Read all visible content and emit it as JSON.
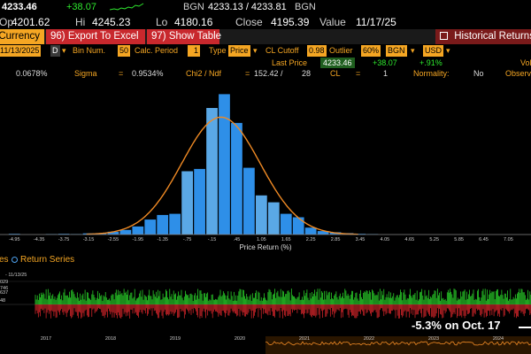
{
  "header": {
    "last": "4233.46",
    "change": "+38.07",
    "bgn_label": "BGN",
    "bid_ask": "4233.13 / 4233.81",
    "bid_ask_src": "BGN",
    "op_label": "Op",
    "op": "4201.62",
    "hi_label": "Hi",
    "hi": "4245.23",
    "lo_label": "Lo",
    "lo": "4180.16",
    "close_label": "Close",
    "close": "4195.39",
    "value_label": "Value",
    "value_date": "11/17/25"
  },
  "toolbar": {
    "currency_label": "Currency",
    "export_num": "96)",
    "export_label": "Export To Excel",
    "show_num": "97)",
    "show_label": "Show Table",
    "hist_label": "Historical Returns"
  },
  "settings": {
    "date": "11/13/2025",
    "period_type": "D",
    "bin_label": "Bin Num.",
    "bin_value": "50",
    "calc_label": "Calc. Period",
    "calc_value": "1",
    "type_label": "Type",
    "type_value": "Price",
    "cutoff_label": "CL Cutoff",
    "cutoff_value": "0.98",
    "outlier_label": "Outlier",
    "outlier_value": "60%",
    "src_value": "BGN",
    "ccy_value": "USD"
  },
  "last_row": {
    "label": "Last Price",
    "price": "4233.46",
    "change": "+38.07",
    "pct": "+.91%",
    "vol_label": "Vol"
  },
  "stats": {
    "mean_value": "0.0678%",
    "sigma_label": "Sigma",
    "sigma_eq": "=",
    "sigma_value": "0.9534%",
    "chi_label": "Chi2 / Ndf",
    "chi_eq": "=",
    "chi_value": "152.42 /",
    "ndf_value": "28",
    "cl_label": "CL",
    "cl_eq": "=",
    "cl_value": "1",
    "norm_label": "Normality:",
    "norm_value": "No",
    "obs_label": "Observ"
  },
  "chart_data": {
    "type": "bar",
    "xlabel": "Price Return (%)",
    "tick_labels": [
      "-4.95",
      "-4.35",
      "-3.75",
      "-3.15",
      "-2.55",
      "-1.95",
      "-1.35",
      "-.75",
      "-.15",
      ".45",
      "1.05",
      "1.65",
      "2.25",
      "2.85",
      "3.45",
      "4.05",
      "4.65",
      "5.25",
      "5.85",
      "6.45",
      "7.05"
    ],
    "tick_labels_short": [
      "-4.95",
      "-4.35",
      "-3.75",
      "-3.15",
      "-2.55",
      "-1.95",
      "-1.35",
      "-.75",
      "-.15",
      ".45",
      "1.05",
      "1.65",
      "2.25",
      "2.85",
      "3.45",
      "4.05",
      "4.65",
      "5.25",
      "5.85",
      "6.45",
      "7.05"
    ],
    "bins_x": [
      -5.1,
      -4.8,
      -4.5,
      -4.2,
      -3.9,
      -3.6,
      -3.3,
      -3.0,
      -2.7,
      -2.4,
      -2.1,
      -1.8,
      -1.5,
      -1.2,
      -0.9,
      -0.6,
      -0.3,
      0.0,
      0.3,
      0.6,
      0.9,
      1.2,
      1.5,
      1.8,
      2.1,
      2.4,
      2.7,
      3.0,
      3.3,
      3.6
    ],
    "bins_y": [
      0.3,
      0,
      0,
      0.2,
      0.3,
      0.2,
      0.5,
      0.6,
      1.2,
      2.0,
      3.5,
      6.5,
      8.5,
      9.0,
      27.5,
      28.5,
      55.0,
      61.0,
      48.5,
      29.0,
      17.0,
      14.0,
      9.0,
      7.5,
      3.0,
      1.5,
      1.0,
      0.6,
      0.3,
      0.2
    ],
    "highlight_bins": [
      -0.9,
      -0.3,
      0.9,
      1.2
    ],
    "fit_mean": 0.0678,
    "fit_sigma": 0.9534,
    "xlim": [
      -5.3,
      7.6
    ],
    "ylim": [
      0,
      65
    ]
  },
  "series_panel": {
    "legend_prefix": "es",
    "legend_label": "Return Series",
    "range_text": "- 11/13/25",
    "axis_vals": [
      "029",
      "746",
      "637",
      "48"
    ],
    "years": [
      "2017",
      "2018",
      "2019",
      "2020",
      "2021",
      "2022",
      "2023",
      "2024"
    ],
    "callout": "-5.3% on Oct. 17"
  },
  "colors": {
    "accent": "#f5a623",
    "bar": "#2e8fe8",
    "bar_hi": "#5aa8e6",
    "fit": "#f08a24",
    "pos": "#2ee82e",
    "neg": "#e8282e"
  }
}
